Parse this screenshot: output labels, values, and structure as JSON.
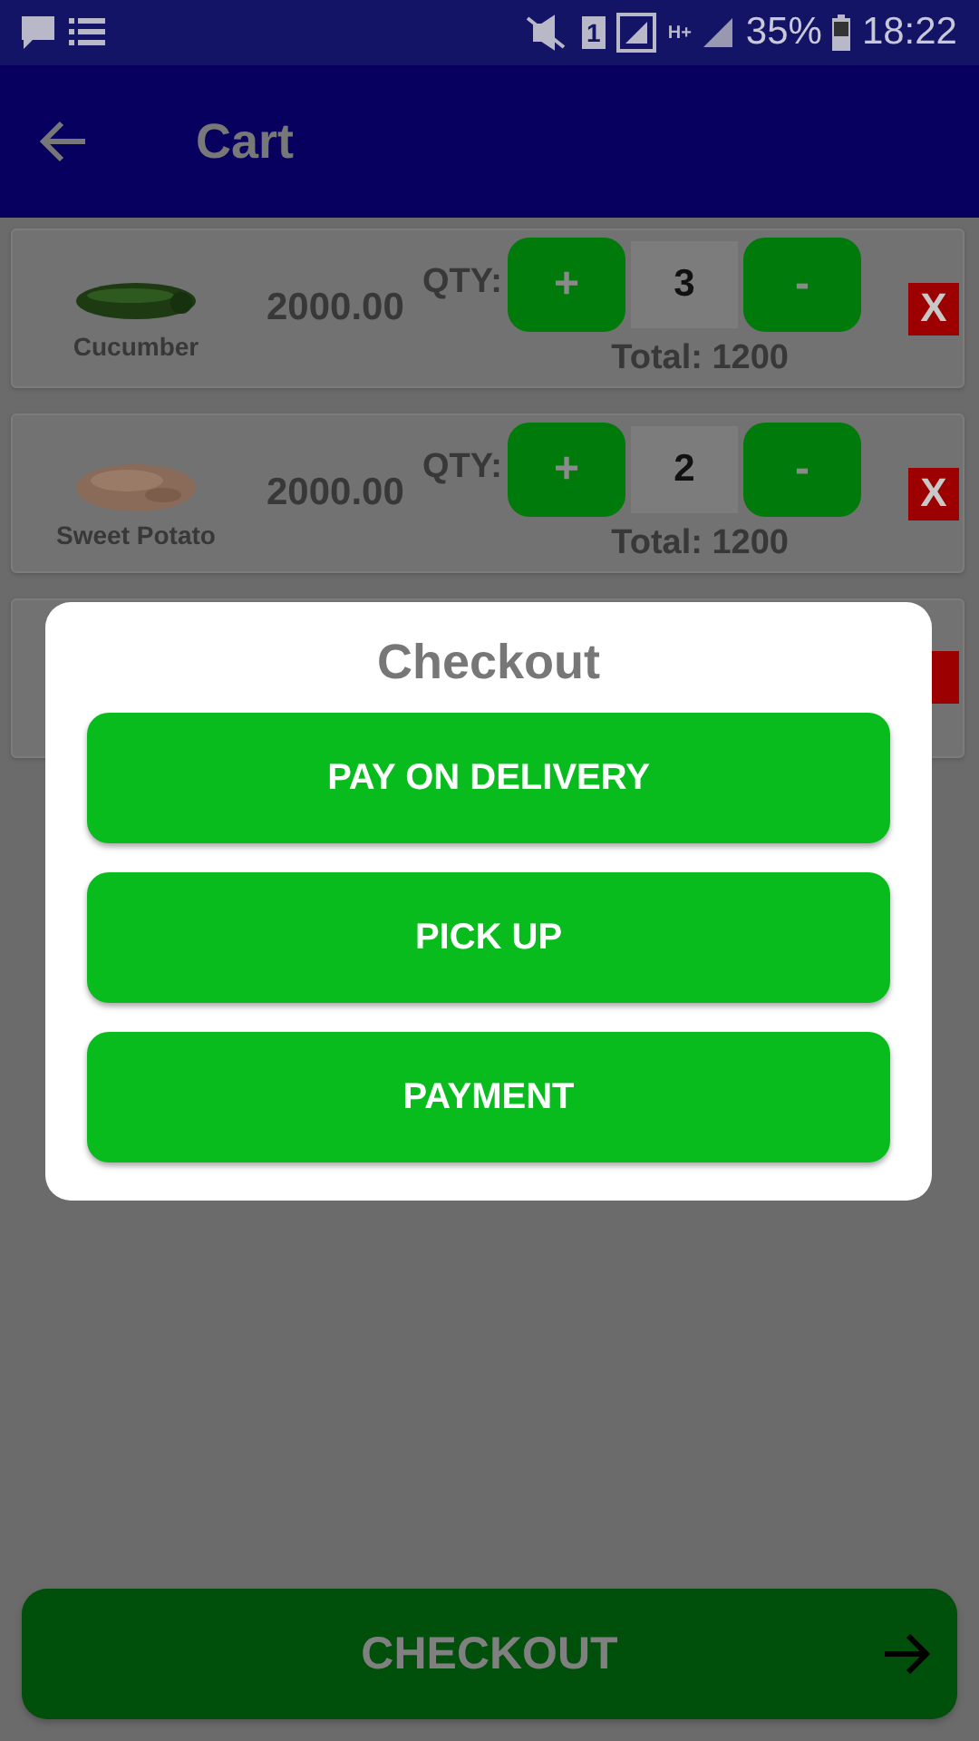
{
  "status_bar": {
    "sim": "1",
    "network": "H+",
    "battery": "35%",
    "time": "18:22"
  },
  "app_bar": {
    "title": "Cart"
  },
  "cart_items": [
    {
      "kind": "item",
      "name": "Cucumber",
      "price": "2000.00",
      "qty_label": "QTY:",
      "plus": "+",
      "quantity": "3",
      "minus": "-",
      "total": "Total: 1200",
      "remove": "X"
    },
    {
      "kind": "item",
      "name": "Sweet Potato",
      "price": "2000.00",
      "qty_label": "QTY:",
      "plus": "+",
      "quantity": "2",
      "minus": "-",
      "total": "Total: 1200",
      "remove": "X"
    },
    {
      "kind": "covered"
    }
  ],
  "dialog": {
    "title": "Checkout",
    "options": [
      "PAY ON DELIVERY",
      "PICK UP",
      "PAYMENT"
    ]
  },
  "checkout_button": {
    "label": "CHECKOUT"
  }
}
